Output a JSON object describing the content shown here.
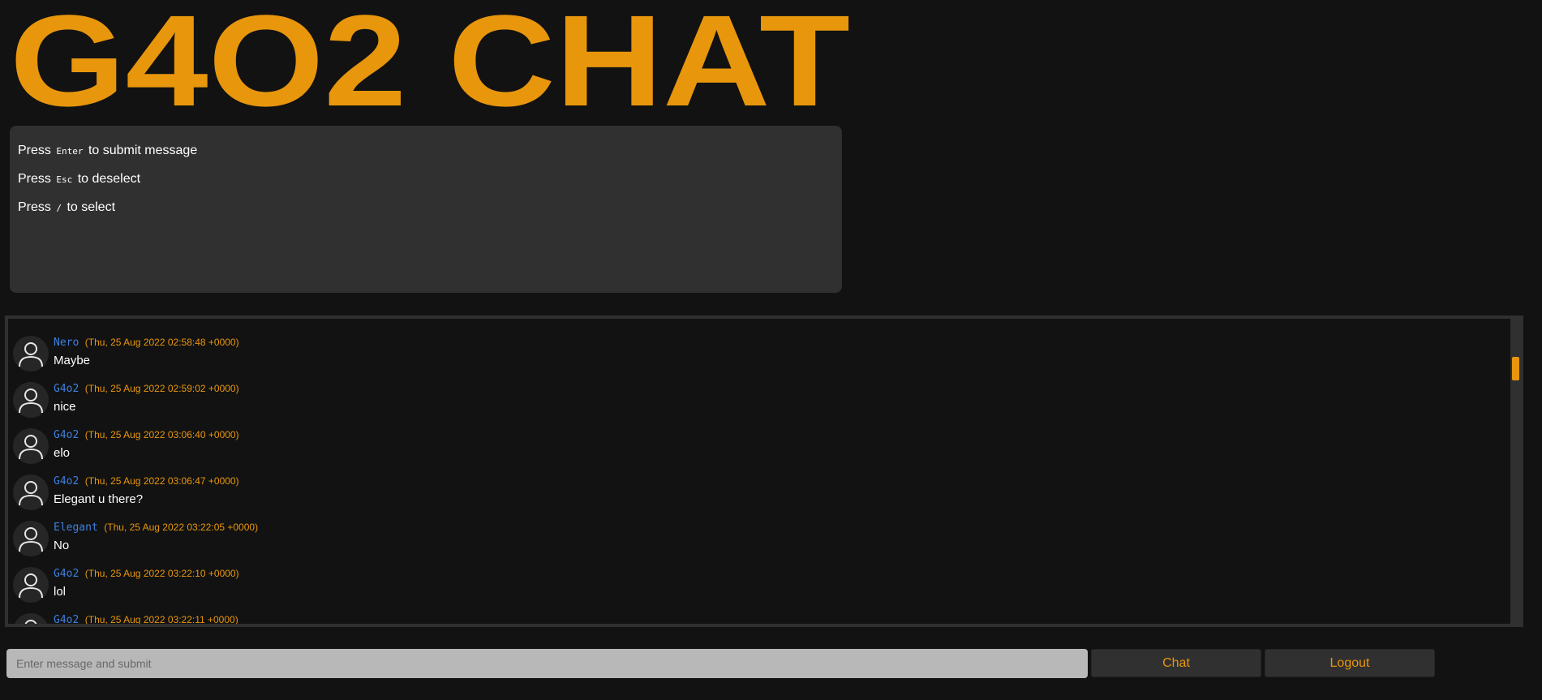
{
  "header": {
    "title": "G4O2 CHAT",
    "title_color": "#e8960c"
  },
  "help": {
    "lines": [
      {
        "prefix": "Press",
        "key": "Enter",
        "suffix": "to submit message"
      },
      {
        "prefix": "Press",
        "key": "Esc",
        "suffix": "to deselect"
      },
      {
        "prefix": "Press",
        "key": "/",
        "suffix": "to select"
      }
    ]
  },
  "chat": {
    "avatar_icon": "user-icon",
    "messages": [
      {
        "user": "Nero",
        "time": "(Thu, 25 Aug 2022 02:58:48 +0000)",
        "text": "Maybe"
      },
      {
        "user": "G4o2",
        "time": "(Thu, 25 Aug 2022 02:59:02 +0000)",
        "text": "nice"
      },
      {
        "user": "G4o2",
        "time": "(Thu, 25 Aug 2022 03:06:40 +0000)",
        "text": "elo"
      },
      {
        "user": "G4o2",
        "time": "(Thu, 25 Aug 2022 03:06:47 +0000)",
        "text": "Elegant u there?"
      },
      {
        "user": "Elegant",
        "time": "(Thu, 25 Aug 2022 03:22:05 +0000)",
        "text": "No"
      },
      {
        "user": "G4o2",
        "time": "(Thu, 25 Aug 2022 03:22:10 +0000)",
        "text": "lol"
      },
      {
        "user": "G4o2",
        "time": "(Thu, 25 Aug 2022 03:22:11 +0000)",
        "text": ""
      }
    ]
  },
  "composer": {
    "placeholder": "Enter message and submit",
    "value": "",
    "chat_label": "Chat",
    "logout_label": "Logout"
  },
  "colors": {
    "accent": "#e8960c",
    "username": "#3d80e0",
    "background": "#121212",
    "panel": "#303030"
  }
}
